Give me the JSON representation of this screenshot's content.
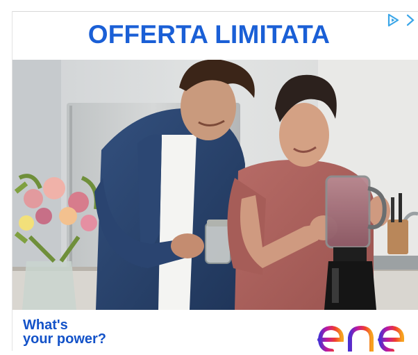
{
  "ad": {
    "headline": "OFFERTA LIMITATA",
    "tagline_line1": "What's",
    "tagline_line2": "your power?",
    "brand": "enel"
  },
  "controls": {
    "adchoices_icon": "adchoices-triangle-icon",
    "close_icon": "close-chevron-icon"
  },
  "colors": {
    "headline": "#1a5fd6",
    "tagline": "#1352c8",
    "adchoices": "#3aa6e8",
    "logo_gradient": [
      "#4b2fd1",
      "#c2189b",
      "#ef3d2f",
      "#f6a21e"
    ]
  },
  "photo": {
    "description_icon": "kitchen-smoothie-photo"
  }
}
